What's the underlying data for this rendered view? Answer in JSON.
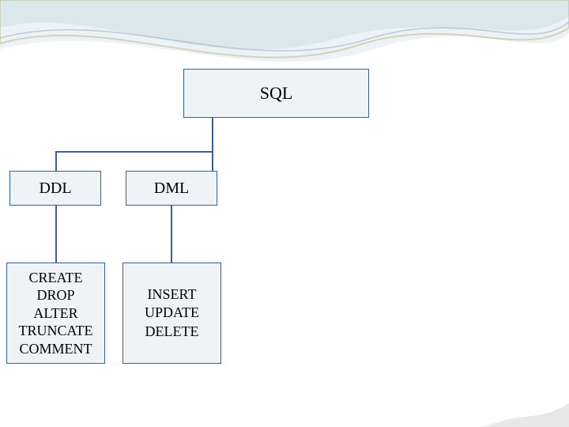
{
  "root": {
    "label": "SQL"
  },
  "children": [
    {
      "label": "DDL",
      "ops": [
        "CREATE",
        "DROP",
        "ALTER",
        "TRUNCATE",
        "COMMENT"
      ]
    },
    {
      "label": "DML",
      "ops": [
        "INSERT",
        "UPDATE",
        "DELETE"
      ]
    }
  ]
}
